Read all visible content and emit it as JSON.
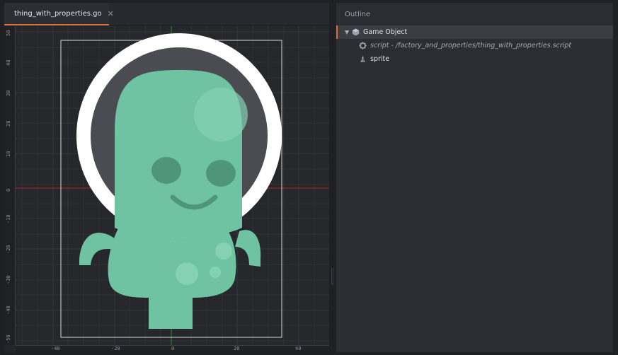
{
  "editor": {
    "tab": {
      "label": "thing_with_properties.go",
      "icon": "game-object-icon",
      "close_glyph": "✕"
    },
    "ruler_left_labels": [
      "50",
      "40",
      "30",
      "20",
      "10",
      "0",
      "-10",
      "-20",
      "-30",
      "-40",
      "-50"
    ],
    "ruler_bottom_labels": [
      "-40",
      "-20",
      "0",
      "20",
      "40"
    ],
    "scene_sprite": "green alien character with white ring"
  },
  "outline": {
    "title": "Outline",
    "items": [
      {
        "label": "Game Object",
        "icon": "game-object-icon",
        "expanded": true,
        "selected": true
      },
      {
        "label": "script - /factory_and_properties/thing_with_properties.script",
        "icon": "gear-icon"
      },
      {
        "label": "sprite",
        "icon": "sprite-icon"
      }
    ]
  },
  "colors": {
    "accent": "#e06c32",
    "alien": "#6fc3a3",
    "x_axis": "#b3262a",
    "y_axis": "#2e8a2e"
  }
}
